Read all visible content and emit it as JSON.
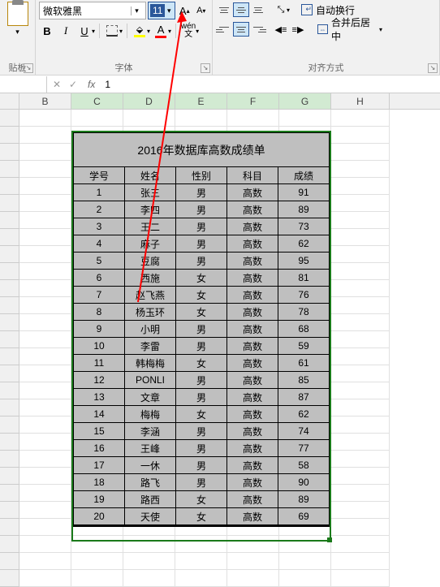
{
  "ribbon": {
    "clipboard": {
      "label": "贴板"
    },
    "font": {
      "label": "字体",
      "name": "微软雅黑",
      "size": "11",
      "bold": "B",
      "italic": "I",
      "underline": "U",
      "grow": "A",
      "shrink": "A",
      "wen_top": "wén",
      "wen_bot": "文",
      "fontcolor_letter": "A",
      "fill_letter": "⬙"
    },
    "align": {
      "label": "对齐方式",
      "wrap": "自动换行",
      "merge": "合并后居中"
    }
  },
  "formula_bar": {
    "fx": "fx",
    "value": "1",
    "cancel": "✕",
    "accept": "✓"
  },
  "columns": [
    "B",
    "C",
    "D",
    "E",
    "F",
    "G",
    "H"
  ],
  "selected_cols": [
    "C",
    "D",
    "E",
    "F",
    "G"
  ],
  "chart_data": {
    "type": "table",
    "title": "2016年数据库高数成绩单",
    "headers": [
      "学号",
      "姓名",
      "性别",
      "科目",
      "成绩"
    ],
    "rows": [
      [
        "1",
        "张三",
        "男",
        "高数",
        "91"
      ],
      [
        "2",
        "李四",
        "男",
        "高数",
        "89"
      ],
      [
        "3",
        "王二",
        "男",
        "高数",
        "73"
      ],
      [
        "4",
        "麻子",
        "男",
        "高数",
        "62"
      ],
      [
        "5",
        "豆腐",
        "男",
        "高数",
        "95"
      ],
      [
        "6",
        "西施",
        "女",
        "高数",
        "81"
      ],
      [
        "7",
        "赵飞燕",
        "女",
        "高数",
        "76"
      ],
      [
        "8",
        "杨玉环",
        "女",
        "高数",
        "78"
      ],
      [
        "9",
        "小明",
        "男",
        "高数",
        "68"
      ],
      [
        "10",
        "李雷",
        "男",
        "高数",
        "59"
      ],
      [
        "11",
        "韩梅梅",
        "女",
        "高数",
        "61"
      ],
      [
        "12",
        "PONLI",
        "男",
        "高数",
        "85"
      ],
      [
        "13",
        "文章",
        "男",
        "高数",
        "87"
      ],
      [
        "14",
        "梅梅",
        "女",
        "高数",
        "62"
      ],
      [
        "15",
        "李涵",
        "男",
        "高数",
        "74"
      ],
      [
        "16",
        "王峰",
        "男",
        "高数",
        "77"
      ],
      [
        "17",
        "一休",
        "男",
        "高数",
        "58"
      ],
      [
        "18",
        "路飞",
        "男",
        "高数",
        "90"
      ],
      [
        "19",
        "路西",
        "女",
        "高数",
        "89"
      ],
      [
        "20",
        "天使",
        "女",
        "高数",
        "69"
      ]
    ]
  }
}
